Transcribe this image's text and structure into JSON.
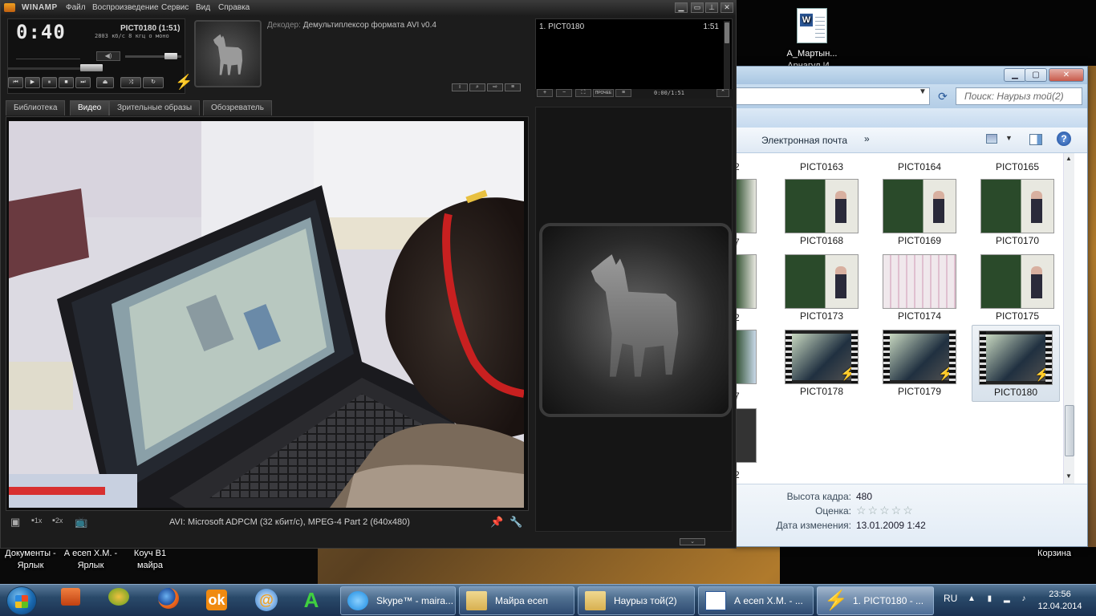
{
  "desktop": {
    "icons": {
      "doc_top": "А_Мартын... Арнагул И...",
      "documents": "Документы - Ярлык",
      "a_esep": "А есеп Х.М. - Ярлык",
      "coach": "Коуч В1 майра",
      "recycle": "Корзина"
    }
  },
  "explorer": {
    "search_placeholder": "Поиск: Наурыз той(2)",
    "toolbar_label": "Электронная почта",
    "toolbar_more": "»",
    "thumbs": [
      {
        "name": "PICT0163"
      },
      {
        "name": "PICT0164"
      },
      {
        "name": "PICT0165"
      },
      {
        "name": "PICT0168"
      },
      {
        "name": "PICT0169"
      },
      {
        "name": "PICT0170"
      },
      {
        "name": "PICT0173"
      },
      {
        "name": "PICT0174"
      },
      {
        "name": "PICT0175"
      },
      {
        "name": "PICT0178"
      },
      {
        "name": "PICT0179"
      },
      {
        "name": "PICT0180"
      }
    ],
    "partial_labels": [
      "2",
      "7",
      "2",
      "7",
      "2"
    ],
    "details": {
      "height_label": "Высота кадра:",
      "height_value": "480",
      "rating_label": "Оценка:",
      "rating_value": "☆☆☆☆☆",
      "modified_label": "Дата изменения:",
      "modified_value": "13.01.2009 1:42"
    }
  },
  "winamp": {
    "title": "WINAMP",
    "menu": [
      "Файл",
      "Воспроизведение",
      "Сервис",
      "Вид",
      "Справка"
    ],
    "time": "0:40",
    "track": "PICT0180 (1:51)",
    "bitrate": "2803 кб/с  8  кгц  о моно",
    "decoder_label": "Декодер:",
    "decoder_value": "Демультиплексор формата AVI v0.4",
    "tabs": [
      "Библиотека",
      "Видео",
      "Зрительные образы",
      "Обозреватель"
    ],
    "status": "AVI: Microsoft ADPCM (32 кбит/с), MPEG-4 Part 2 (640x480)",
    "zoom_1x": "1x",
    "zoom_2x": "2x",
    "playlist": {
      "item": "1. PICT0180",
      "item_duration": "1:51",
      "time": "0:00/1:51",
      "buttons": [
        "+",
        "−",
        "⛶",
        "ПРОЧЕЕ",
        "≡"
      ]
    },
    "volume": 0.9,
    "seek": 0.36
  },
  "taskbar": {
    "tasks": [
      "Skype™ - maira...",
      "Майра есеп",
      "Наурыз той(2)",
      "А есеп Х.М. - ...",
      "1. PICT0180 - ..."
    ],
    "lang": "RU",
    "time": "23:56",
    "date": "12.04.2014"
  }
}
